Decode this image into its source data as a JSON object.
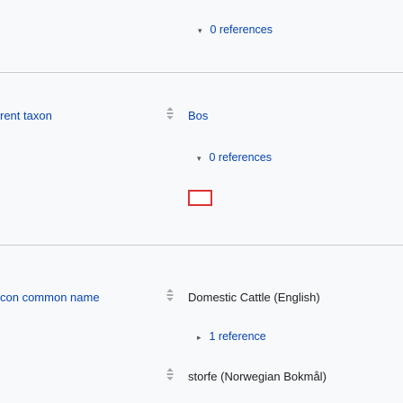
{
  "statements": [
    {
      "references_toggle": "0 references"
    },
    {
      "property_label": "rent taxon",
      "value": "Bos",
      "references_toggle": "0 references"
    },
    {
      "property_label": "con common name",
      "values": [
        {
          "text": "Domestic Cattle",
          "language": "(English)",
          "references_toggle": "1 reference"
        },
        {
          "text": "storfe",
          "language": "(Norwegian Bokmål)"
        }
      ]
    }
  ],
  "icons": {
    "rank": "rank-normal-icon",
    "collapse_arrow": "chevron-down-icon",
    "expand_arrow": "chevron-right-icon"
  },
  "colors": {
    "link": "#0645ad",
    "section_background": "#f8f9fa",
    "divider": "#c8ccd1",
    "highlight_box": "#dd3333"
  }
}
